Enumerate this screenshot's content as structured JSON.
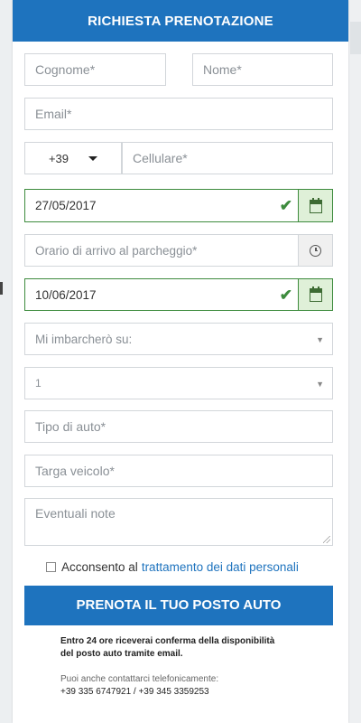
{
  "form": {
    "title": "RICHIESTA PRENOTAZIONE",
    "surname_placeholder": "Cognome*",
    "name_placeholder": "Nome*",
    "email_placeholder": "Email*",
    "phone_prefix": "+39",
    "mobile_placeholder": "Cellulare*",
    "arrival_date": "27/05/2017",
    "arrival_time_placeholder": "Orario di arrivo al parcheggio*",
    "return_date": "10/06/2017",
    "embark_select": "Mi imbarcherò su:",
    "quantity_select": "1",
    "car_type_placeholder": "Tipo di auto*",
    "plate_placeholder": "Targa veicolo*",
    "notes_placeholder": "Eventuali note",
    "consent_text": "Acconsento al",
    "consent_link": "trattamento dei dati personali",
    "submit_label": "PRENOTA IL TUO POSTO AUTO",
    "info_line1": "Entro 24 ore riceverai conferma della disponibilità",
    "info_line2": "del posto auto tramite email.",
    "contact_line": "Puoi anche contattarci telefonicamente:",
    "phones": "+39 335 6747921 / +39 345 3359253"
  },
  "colors": {
    "accent": "#1e73be",
    "valid": "#3d8b3d",
    "valid_bg": "#dff0d8"
  },
  "icons": [
    "checkmark-icon",
    "calendar-icon",
    "clock-icon",
    "caret-down-icon",
    "resize-icon"
  ]
}
